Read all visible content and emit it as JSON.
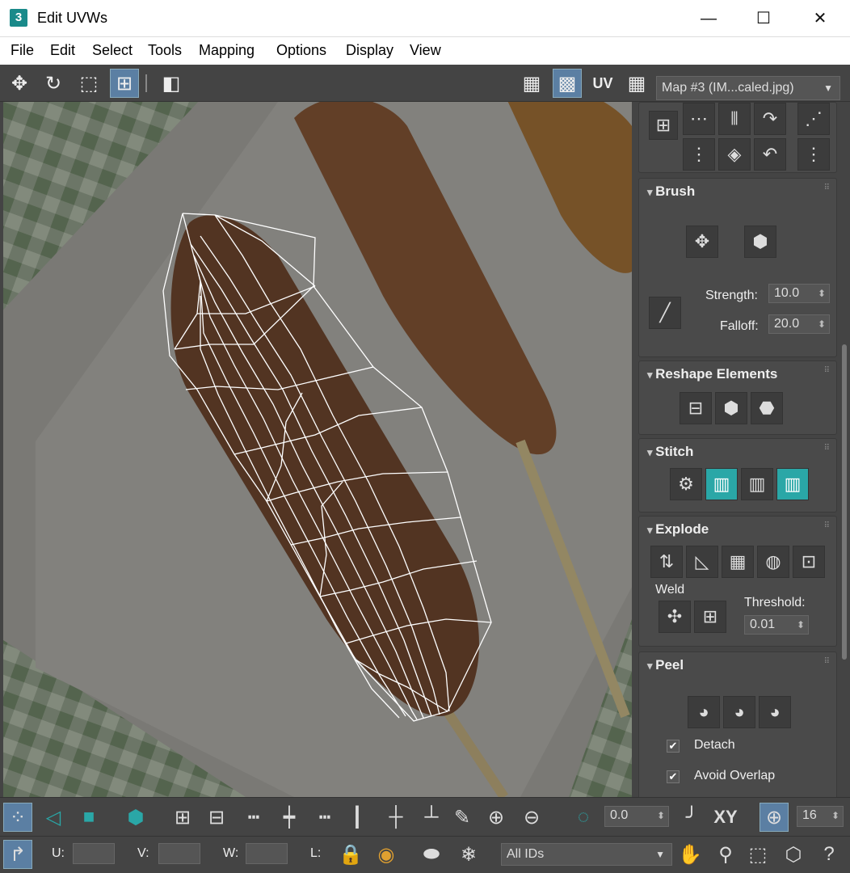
{
  "window": {
    "title": "Edit UVWs",
    "app_icon": "3",
    "minimize": "—",
    "maximize": "☐",
    "close": "✕"
  },
  "menu": [
    "File",
    "Edit",
    "Select",
    "Tools",
    "Mapping",
    "Options",
    "Display",
    "View"
  ],
  "toolbar_top": {
    "uv_label": "UV",
    "map_dropdown": "Map #3 (IM...caled.jpg)"
  },
  "panel": {
    "brush": {
      "title": "Brush",
      "strength_label": "Strength:",
      "strength_value": "10.0",
      "falloff_label": "Falloff:",
      "falloff_value": "20.0"
    },
    "reshape": {
      "title": "Reshape Elements"
    },
    "stitch": {
      "title": "Stitch"
    },
    "explode": {
      "title": "Explode",
      "weld_label": "Weld",
      "threshold_label": "Threshold:",
      "threshold_value": "0.01"
    },
    "peel": {
      "title": "Peel",
      "detach_label": "Detach",
      "avoid_overlap_label": "Avoid Overlap"
    }
  },
  "toolbar_bottom": {
    "rotation_value": "0.0",
    "xy_label": "XY",
    "grid_value": "16",
    "u_label": "U:",
    "v_label": "V:",
    "w_label": "W:",
    "l_label": "L:",
    "ids_dropdown": "All IDs"
  },
  "colors": {
    "accent": "#2aa7a7",
    "active": "#5b7fa3",
    "toolbar_bg": "#444444"
  }
}
